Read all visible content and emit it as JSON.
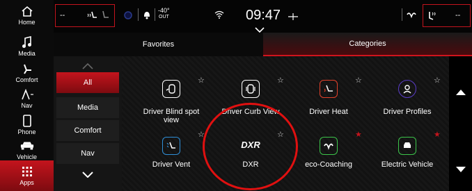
{
  "colors": {
    "accent": "#c4141d",
    "highlight_circle": "#e01010"
  },
  "left_nav": {
    "items": [
      {
        "label": "Home",
        "icon": "home-icon"
      },
      {
        "label": "Media",
        "icon": "music-note-icon"
      },
      {
        "label": "Comfort",
        "icon": "seat-icon"
      },
      {
        "label": "Nav",
        "icon": "nav-arrow-icon"
      },
      {
        "label": "Phone",
        "icon": "phone-icon"
      },
      {
        "label": "Vehicle",
        "icon": "car-icon"
      },
      {
        "label": "Apps",
        "icon": "apps-grid-icon"
      }
    ]
  },
  "status_bar": {
    "left_setting": "--",
    "right_setting": "--",
    "temp_value": "-40°",
    "temp_label": "OUT",
    "time": "09:47"
  },
  "tabs": [
    {
      "label": "Favorites"
    },
    {
      "label": "Categories"
    }
  ],
  "categories": [
    {
      "label": "All"
    },
    {
      "label": "Media"
    },
    {
      "label": "Comfort"
    },
    {
      "label": "Nav"
    }
  ],
  "apps": [
    {
      "title": "Driver Blind spot view",
      "title_line1": "Driver Blind spot",
      "title_line2": "view",
      "icon": "blind-spot-icon",
      "color": "#ffffff",
      "favorite": false
    },
    {
      "title": "Driver Curb View",
      "icon": "curb-view-icon",
      "color": "#ffffff",
      "favorite": false
    },
    {
      "title": "Driver Heat",
      "icon": "heated-seat-icon",
      "color": "#e2402a",
      "favorite": false
    },
    {
      "title": "Driver Profiles",
      "icon": "profile-icon",
      "color": "#5a3cc8",
      "favorite": false
    },
    {
      "title": "Driver Vent",
      "icon": "vent-seat-icon",
      "color": "#2f8fd8",
      "favorite": false
    },
    {
      "title": "DXR",
      "logo": "DXR",
      "color": "#ffffff",
      "favorite": false
    },
    {
      "title": "eco-Coaching",
      "icon": "eco-leaf-icon",
      "color": "#3cc44a",
      "favorite": true
    },
    {
      "title": "Electric Vehicle",
      "icon": "ev-icon",
      "color": "#3cc44a",
      "favorite": true
    }
  ]
}
